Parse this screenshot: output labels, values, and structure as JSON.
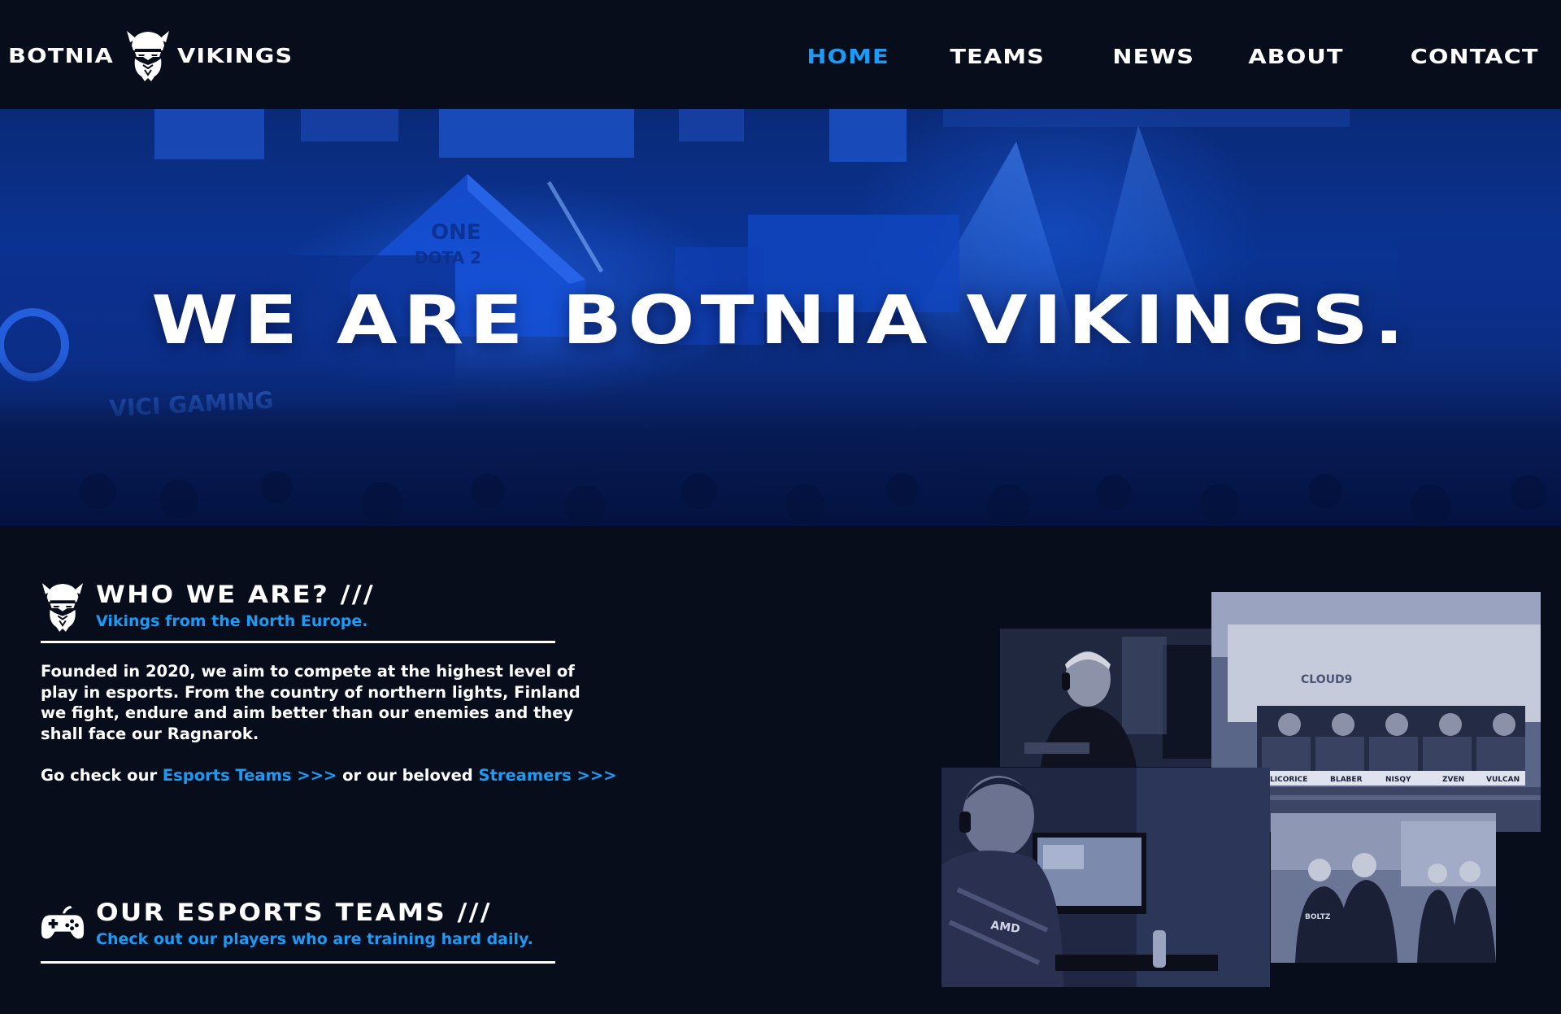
{
  "brand": {
    "left_word": "BOTNIA",
    "right_word": "VIKINGS",
    "logo_icon": "viking-head-icon"
  },
  "nav": {
    "items": [
      {
        "label": "HOME",
        "active": true
      },
      {
        "label": "TEAMS",
        "active": false
      },
      {
        "label": "NEWS",
        "active": false
      },
      {
        "label": "ABOUT",
        "active": false
      },
      {
        "label": "CONTACT",
        "active": false
      }
    ]
  },
  "hero": {
    "title": "WE ARE BOTNIA VIKINGS.",
    "image": "esports-arena-photo",
    "image_texts": [
      "VICI GAMING",
      "ONE ESPORTS DOTA 2"
    ]
  },
  "about": {
    "title": "WHO WE ARE? ///",
    "subtitle": "Vikings from the North Europe.",
    "icon": "viking-head-icon",
    "paragraph": "Founded in 2020, we aim to compete at the highest level of play in esports. From the country of northern lights, Finland we fight, endure and aim better than our enemies and they shall face our Ragnarok.",
    "cta_prefix": "Go check our ",
    "cta_link_1": "Esports Teams >>>",
    "cta_middle": " or our beloved ",
    "cta_link_2": "Streamers >>>"
  },
  "teams": {
    "title": "OUR ESPORTS TEAMS ///",
    "subtitle": "Check out our players who are training hard daily.",
    "icon": "gamepad-icon"
  },
  "collage": {
    "photos": [
      {
        "name": "player-headset-photo"
      },
      {
        "name": "stage-team-photo",
        "nameplates": [
          "LICORICE",
          "BLABER",
          "NISQY",
          "ZVEN",
          "VULCAN"
        ],
        "banner": "CLOUD9"
      },
      {
        "name": "player-playing-photo",
        "jersey": "AMD"
      },
      {
        "name": "team-huddle-photo",
        "jersey": "BOLTZ"
      }
    ]
  },
  "colors": {
    "background": "#080d1c",
    "accent": "#1a9bf5",
    "hero_tint": "#0b3496",
    "text": "#ffffff"
  }
}
